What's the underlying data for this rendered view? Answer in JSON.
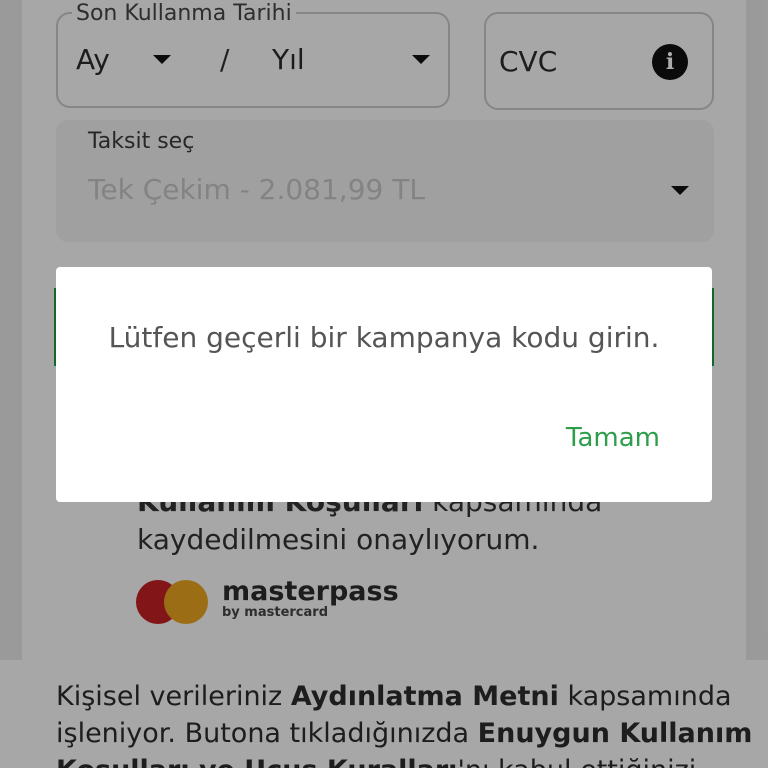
{
  "form": {
    "expiry": {
      "label": "Son Kullanma Tarihi",
      "month": "Ay",
      "separator": "/",
      "year": "Yıl"
    },
    "cvc": {
      "label": "CVC",
      "info_icon": "info-icon"
    },
    "installment": {
      "label": "Taksit seç",
      "value": "Tek Çekim - 2.081,99 TL"
    }
  },
  "consent": {
    "partial_bold": "Kullanım Koşulları",
    "partial_rest": " kapsamında",
    "line2": "kaydedilmesini onaylıyorum."
  },
  "masterpass": {
    "name": "masterpass",
    "sub": "by mastercard",
    "colors": {
      "red": "#c01f24",
      "orange": "#e5a21f"
    }
  },
  "legal": {
    "t1": "Kişisel verileriniz ",
    "b1": "Aydınlatma Metni",
    "t2": " kapsamında işleniyor. Butona tıkladığınızda ",
    "b2": "Enuygun Kullanım Koşulları ve Uçuş Kuralları",
    "t3": "'nı kabul ettiğinizi"
  },
  "dialog": {
    "message": "Lütfen geçerli bir kampanya kodu girin.",
    "ok_label": "Tamam"
  },
  "colors": {
    "accent_green": "#2e9e4a",
    "scrim": "rgba(0,0,0,0.32)"
  }
}
